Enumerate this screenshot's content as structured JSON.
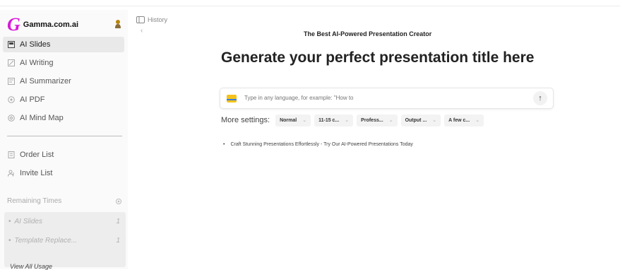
{
  "sidebar": {
    "logo_letter": "G",
    "logo_text": "Gamma.com.ai",
    "items": [
      {
        "label": "AI Slides",
        "icon": "slides-icon"
      },
      {
        "label": "AI Writing",
        "icon": "writing-icon"
      },
      {
        "label": "AI Summarizer",
        "icon": "summarizer-icon"
      },
      {
        "label": "AI PDF",
        "icon": "pdf-icon"
      },
      {
        "label": "AI Mind Map",
        "icon": "mindmap-icon"
      }
    ],
    "secondary_items": [
      {
        "label": "Order List",
        "icon": "order-icon"
      },
      {
        "label": "Invite List",
        "icon": "invite-icon"
      }
    ],
    "remaining_label": "Remaining Times",
    "usage": [
      {
        "label": "AI Slides",
        "count": "1"
      },
      {
        "label": "Template Replace...",
        "count": "1"
      }
    ],
    "view_all": "View All Usage"
  },
  "main": {
    "history_label": "History",
    "subtitle": "The Best AI-Powered Presentation Creator",
    "title": "Generate your perfect presentation title here",
    "input_placeholder": "Type in any language, for example: \"How to",
    "settings_label": "More settings:",
    "settings": [
      "Normal",
      "11-15 c...",
      "Profess...",
      "Output ...",
      "A few c..."
    ],
    "bullet": "Craft Stunning Presentations Effortlessly - Try Our AI-Powered Presentations Today"
  },
  "colors": {
    "brand": "#d81ad8",
    "active_bg": "#e9e9e9"
  }
}
